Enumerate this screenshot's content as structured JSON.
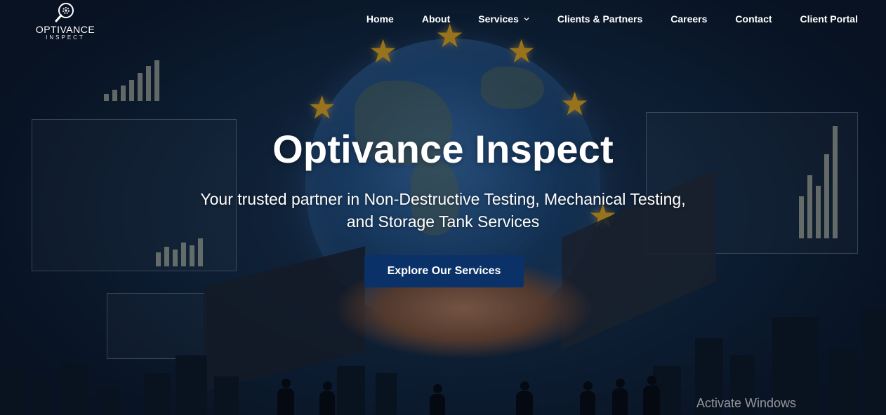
{
  "brand": {
    "name_line1": "OPTIVANCE",
    "name_line2": "INSPECT",
    "logo_icon": "gear-magnifier-icon"
  },
  "nav": {
    "items": [
      {
        "label": "Home"
      },
      {
        "label": "About"
      },
      {
        "label": "Services",
        "icon": "chevron-down-icon"
      },
      {
        "label": "Clients & Partners"
      },
      {
        "label": "Careers"
      },
      {
        "label": "Contact"
      },
      {
        "label": "Client Portal"
      }
    ]
  },
  "hero": {
    "title": "Optivance Inspect",
    "subtitle": "Your trusted partner in Non-Destructive Testing, Mechanical Testing, and Storage Tank Services",
    "cta_label": "Explore Our Services"
  },
  "system": {
    "watermark": "Activate Windows"
  },
  "colors": {
    "cta_bg": "#0a3168",
    "star": "#f2b21c",
    "text": "#ffffff"
  }
}
